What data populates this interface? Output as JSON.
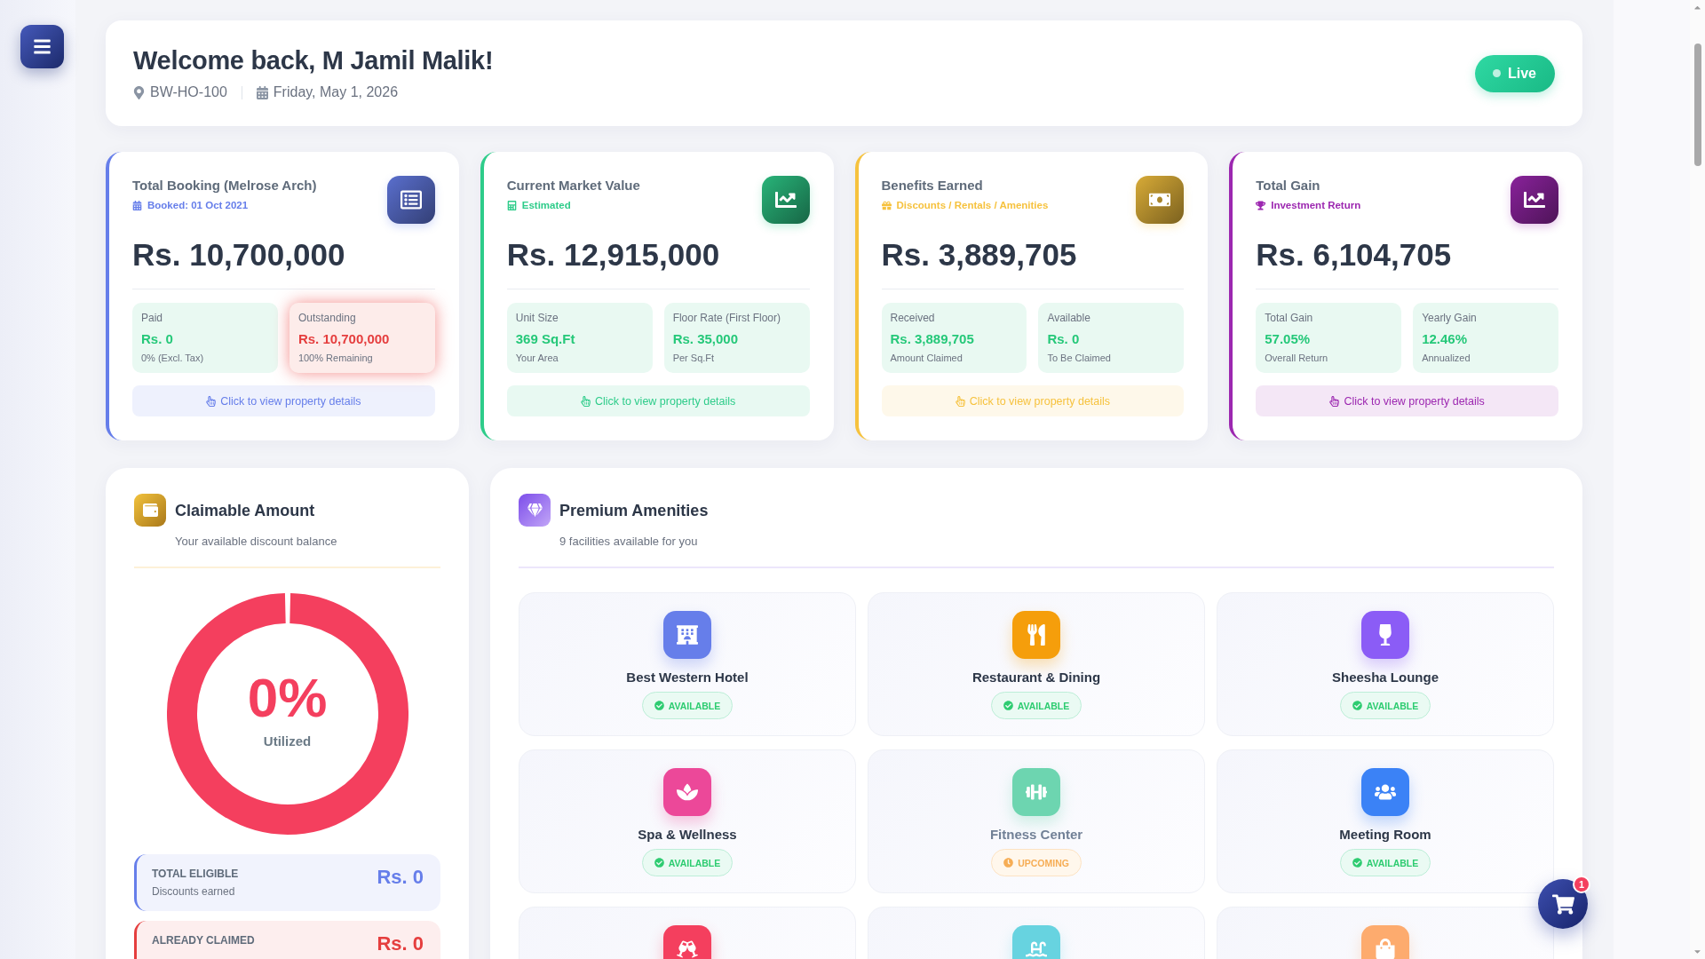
{
  "header": {
    "title": "Welcome back, M Jamil Malik!",
    "location": "BW-HO-100",
    "date": "Friday, May 1, 2026",
    "status": "Live"
  },
  "stat_cards": [
    {
      "title": "Total Booking (Melrose Arch)",
      "subtitle": "Booked: 01 Oct 2021",
      "value": "Rs. 10,700,000",
      "color": "#667eea",
      "tiles": [
        {
          "label": "Paid",
          "value": "Rs. 0",
          "note": "0% (Excl. Tax)",
          "kind": "positive"
        },
        {
          "label": "Outstanding",
          "value": "Rs. 10,700,000",
          "note": "100% Remaining",
          "kind": "negative"
        }
      ],
      "link": "Click to view property details"
    },
    {
      "title": "Current Market Value",
      "subtitle": "Estimated",
      "value": "Rs. 12,915,000",
      "color": "#2ecc8a",
      "tiles": [
        {
          "label": "Unit Size",
          "value": "369 Sq.Ft",
          "note": "Your Area",
          "kind": "positive"
        },
        {
          "label": "Floor Rate (First Floor)",
          "value": "Rs. 35,000",
          "note": "Per Sq.Ft",
          "kind": "positive"
        }
      ],
      "link": "Click to view property details"
    },
    {
      "title": "Benefits Earned",
      "subtitle": "Discounts / Rentals / Amenities",
      "value": "Rs. 3,889,705",
      "color": "#f6c23e",
      "tiles": [
        {
          "label": "Received",
          "value": "Rs. 3,889,705",
          "note": "Amount Claimed",
          "kind": "positive"
        },
        {
          "label": "Available",
          "value": "Rs. 0",
          "note": "To Be Claimed",
          "kind": "positive"
        }
      ],
      "link": "Click to view property details"
    },
    {
      "title": "Total Gain",
      "subtitle": "Investment Return",
      "value": "Rs. 6,104,705",
      "color": "#9c27b0",
      "tiles": [
        {
          "label": "Total Gain",
          "value": "57.05%",
          "note": "Overall Return",
          "kind": "positive"
        },
        {
          "label": "Yearly Gain",
          "value": "12.46%",
          "note": "Annualized",
          "kind": "positive"
        }
      ],
      "link": "Click to view property details"
    }
  ],
  "claimable": {
    "title": "Claimable Amount",
    "subtitle": "Your available discount balance",
    "donut": {
      "value": "0%",
      "label": "Utilized"
    },
    "summary": [
      {
        "label": "TOTAL ELIGIBLE",
        "note": "Discounts earned",
        "value": "Rs. 0",
        "color": "#667eea"
      },
      {
        "label": "ALREADY CLAIMED",
        "value": "Rs. 0",
        "color": "#e53e3e"
      }
    ]
  },
  "amenities": {
    "title": "Premium Amenities",
    "subtitle": "9 facilities available for you",
    "items": [
      {
        "name": "Best Western Hotel",
        "status": "AVAILABLE",
        "kind": "available",
        "color": "#667eea"
      },
      {
        "name": "Restaurant & Dining",
        "status": "AVAILABLE",
        "kind": "available",
        "color": "#f59e0b"
      },
      {
        "name": "Sheesha Lounge",
        "status": "AVAILABLE",
        "kind": "available",
        "color": "#8b5cf6"
      },
      {
        "name": "Spa & Wellness",
        "status": "AVAILABLE",
        "kind": "available",
        "color": "#ec4899"
      },
      {
        "name": "Fitness Center",
        "status": "UPCOMING",
        "kind": "upcoming",
        "color": "#6dd5b0"
      },
      {
        "name": "Meeting Room",
        "status": "AVAILABLE",
        "kind": "available",
        "color": "#3b82f6"
      },
      {
        "color": "#f43f5e"
      },
      {
        "color": "#67d3e0"
      },
      {
        "color": "#fdab6e"
      }
    ]
  },
  "cart": {
    "count": "1"
  }
}
